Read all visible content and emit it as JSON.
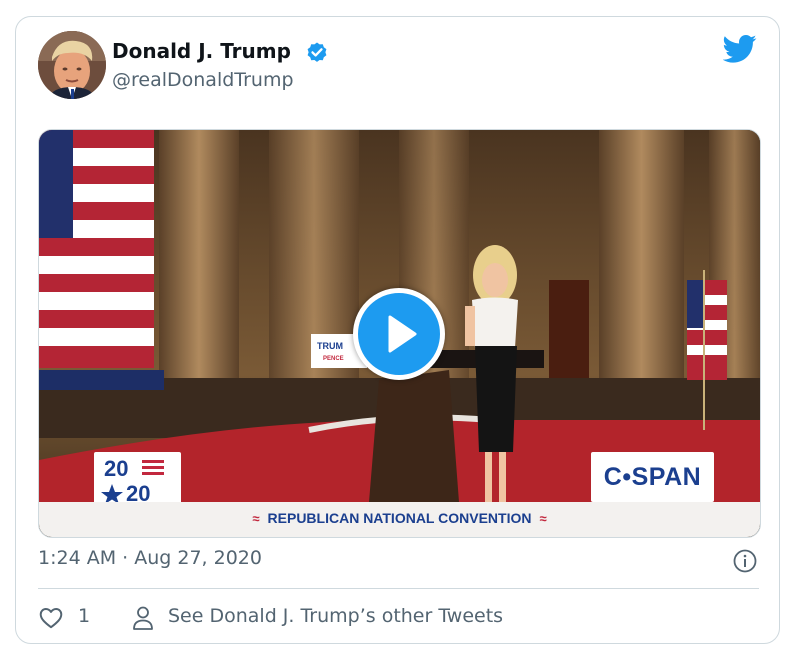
{
  "tweet": {
    "author": {
      "name": "Donald J. Trump",
      "handle": "@realDonaldTrump",
      "verified": true
    },
    "media": {
      "type": "video",
      "logo_top": "20",
      "logo_bottom": "20",
      "broadcaster": "C•SPAN",
      "lower_third": "REPUBLICAN NATIONAL CONVENTION",
      "podium_sign_line1": "TRUM",
      "podium_sign_line2": "PENCE"
    },
    "timestamp": "1:24 AM · Aug 27, 2020",
    "actions": {
      "like_count": "1",
      "other_tweets_label": "See Donald J. Trump’s other Tweets"
    }
  },
  "colors": {
    "twitter_blue": "#1d9bf0",
    "muted_text": "#536471",
    "border": "#cfd9de"
  }
}
